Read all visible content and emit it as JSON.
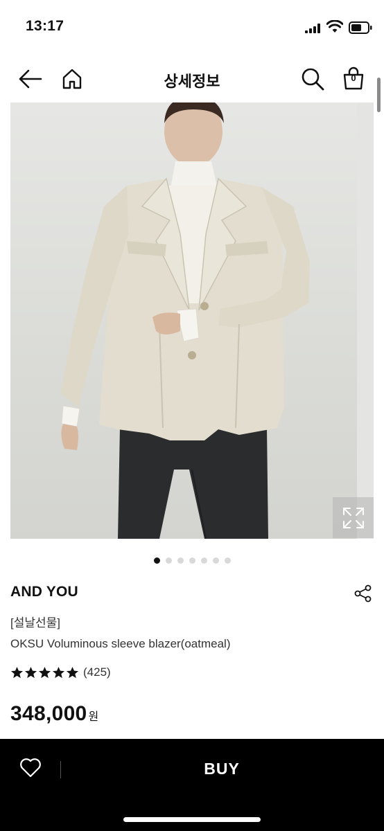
{
  "status_bar": {
    "time": "13:17"
  },
  "nav": {
    "title": "상세정보",
    "cart_count": "0"
  },
  "gallery": {
    "dots_total": 7,
    "active_index": 0
  },
  "product": {
    "brand": "AND YOU",
    "tag": "[설날선물]",
    "name": "OKSU Voluminous sleeve blazer(oatmeal)",
    "rating_stars": 5,
    "review_count": "(425)",
    "price": "348,000",
    "currency": "원"
  },
  "bottom_bar": {
    "buy_label": "BUY"
  }
}
